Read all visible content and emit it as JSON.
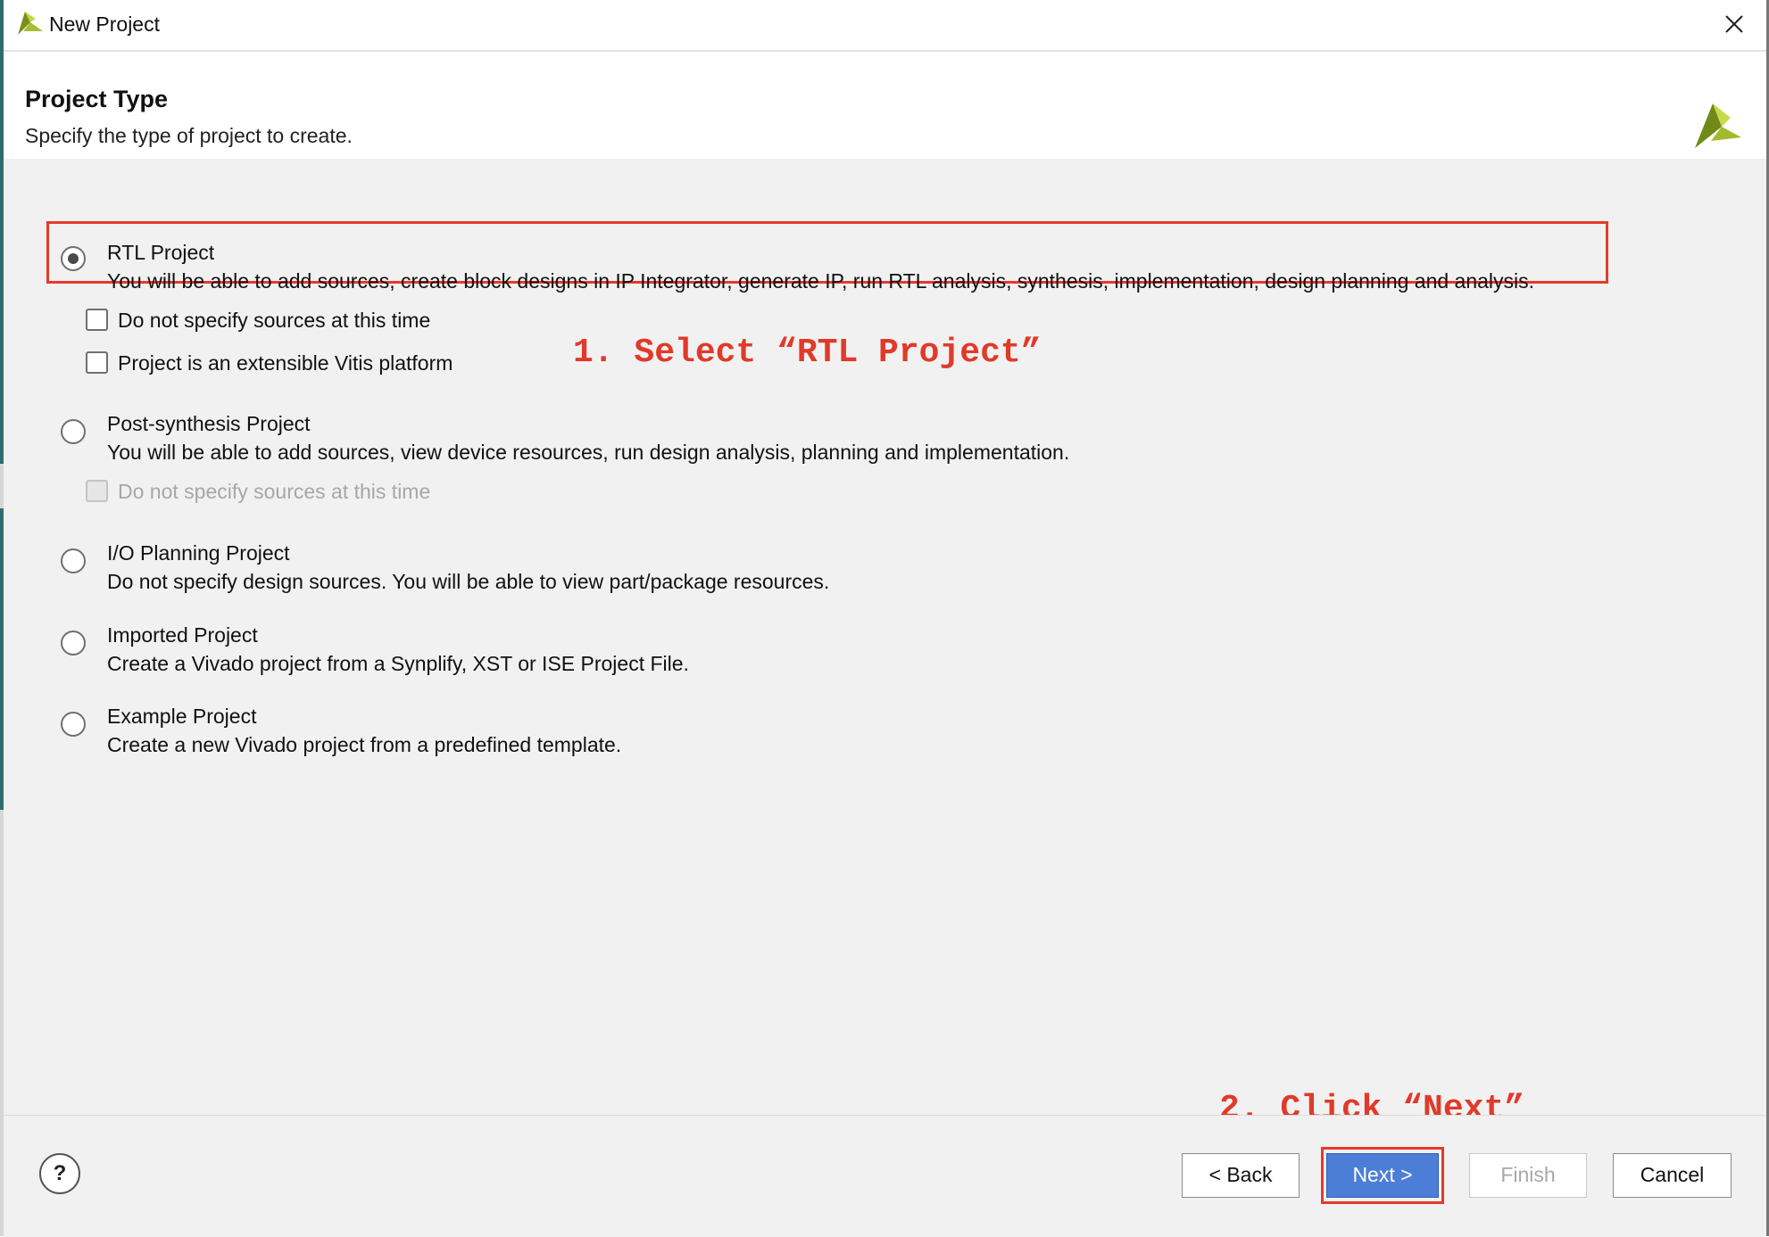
{
  "window": {
    "title": "New Project",
    "app_icon": "vivado-logo-icon",
    "close_icon": "close-icon"
  },
  "header": {
    "heading": "Project Type",
    "subheading": "Specify the type of project to create.",
    "brand_icon": "vivado-logo-icon"
  },
  "options": [
    {
      "title": "RTL Project",
      "description": "You will be able to add sources, create block designs in IP Integrator, generate IP, run RTL analysis, synthesis, implementation, design planning and analysis.",
      "selected": true
    },
    {
      "title": "Post-synthesis Project",
      "description": "You will be able to add sources, view device resources, run design analysis, planning and implementation.",
      "selected": false
    },
    {
      "title": "I/O Planning Project",
      "description": "Do not specify design sources. You will be able to view part/package resources.",
      "selected": false
    },
    {
      "title": "Imported Project",
      "description": "Create a Vivado project from a Synplify, XST or ISE Project File.",
      "selected": false
    },
    {
      "title": "Example Project",
      "description": "Create a new Vivado project from a predefined template.",
      "selected": false
    }
  ],
  "rtl_checkboxes": [
    {
      "label": "Do not specify sources at this time",
      "checked": false,
      "enabled": true
    },
    {
      "label": "Project is an extensible Vitis platform",
      "checked": false,
      "enabled": true
    }
  ],
  "post_synth_checkbox": {
    "label": "Do not specify sources at this time",
    "checked": false,
    "enabled": false
  },
  "annotations": {
    "step1": "1. Select “RTL Project”",
    "step2": "2. Click “Next”",
    "color": "#e03a2a"
  },
  "footer": {
    "help_label": "?",
    "back_label": "< Back",
    "next_label": "Next >",
    "finish_label": "Finish",
    "cancel_label": "Cancel"
  },
  "colors": {
    "primary_button": "#4c7ed8",
    "highlight": "#e53a2b"
  }
}
